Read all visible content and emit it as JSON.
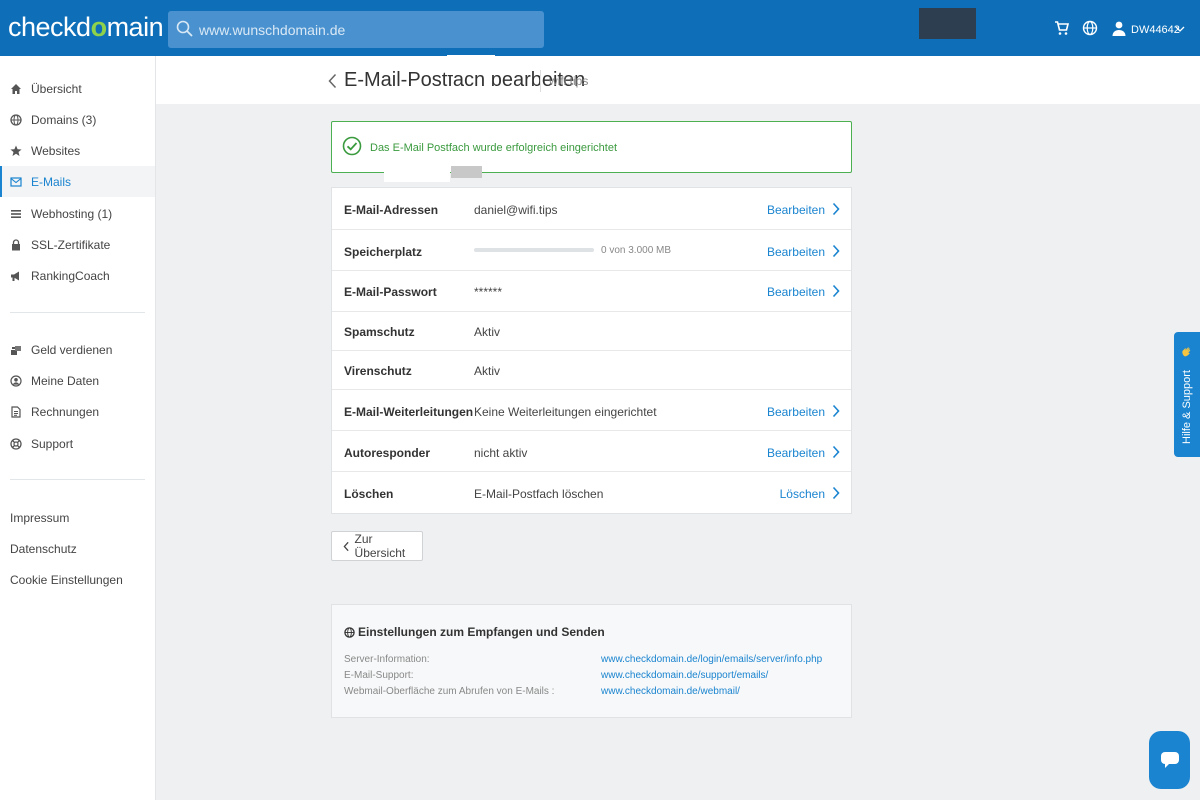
{
  "header": {
    "logo_text_1": "checkd",
    "logo_check": "o",
    "logo_text_2": "main",
    "search_placeholder": "www.wunschdomain.de",
    "user_label": "DW44642"
  },
  "sidebar": {
    "items": [
      {
        "label": "Übersicht",
        "icon": "home-icon"
      },
      {
        "label": "Domains (3)",
        "icon": "globe-icon"
      },
      {
        "label": "Websites",
        "icon": "star-icon"
      },
      {
        "label": "E-Mails",
        "icon": "mail-icon",
        "active": true
      },
      {
        "label": "Webhosting (1)",
        "icon": "list-icon"
      },
      {
        "label": "SSL-Zertifikate",
        "icon": "lock-icon"
      },
      {
        "label": "RankingCoach",
        "icon": "megaphone-icon"
      }
    ],
    "items2": [
      {
        "label": "Geld verdienen",
        "icon": "coins-icon"
      },
      {
        "label": "Meine Daten",
        "icon": "user-circle-icon"
      },
      {
        "label": "Rechnungen",
        "icon": "document-icon"
      },
      {
        "label": "Support",
        "icon": "lifebuoy-icon"
      }
    ],
    "footer_links": [
      "Impressum",
      "Datenschutz",
      "Cookie Einstellungen"
    ]
  },
  "page": {
    "title": "E-Mail-Postfach bearbeiten",
    "domain": "wifi.tips"
  },
  "alert": {
    "message": "Das E-Mail Postfach wurde erfolgreich eingerichtet",
    "color": "#4caf50"
  },
  "details": {
    "rows": [
      {
        "label": "E-Mail-Adressen",
        "value": "daniel@wifi.tips",
        "action": "Bearbeiten"
      },
      {
        "label": "Speicherplatz",
        "value": "",
        "progress_label": "0 von 3.000 MB",
        "progress": 0.0,
        "action": "Bearbeiten"
      },
      {
        "label": "E-Mail-Passwort",
        "value": "******",
        "action": "Bearbeiten"
      },
      {
        "label": "Spamschutz",
        "value": "Aktiv",
        "action": ""
      },
      {
        "label": "Virenschutz",
        "value": "Aktiv",
        "action": ""
      },
      {
        "label": "E-Mail-Weiterleitungen",
        "value": "Keine Weiterleitungen eingerichtet",
        "action": "Bearbeiten"
      },
      {
        "label": "Autoresponder",
        "value": "nicht aktiv",
        "action": "Bearbeiten"
      },
      {
        "label": "Löschen",
        "value": "E-Mail-Postfach löschen",
        "action": "Löschen"
      }
    ]
  },
  "back_button": {
    "label": "Zur Übersicht"
  },
  "settings": {
    "title": "Einstellungen zum Empfangen und Senden",
    "rows": [
      {
        "key": "Server-Information:",
        "value": "www.checkdomain.de/login/emails/server/info.php"
      },
      {
        "key": "E-Mail-Support:",
        "value": "www.checkdomain.de/support/emails/"
      },
      {
        "key": "Webmail-Oberfläche zum Abrufen von E-Mails :",
        "value": "www.checkdomain.de/webmail/"
      }
    ]
  },
  "help_tab": {
    "label": "Hilfe & Support"
  },
  "colors": {
    "brand": "#0e6fb8",
    "accent": "#1a84d0",
    "success": "#4caf50",
    "logo_check": "#8ed14b"
  }
}
